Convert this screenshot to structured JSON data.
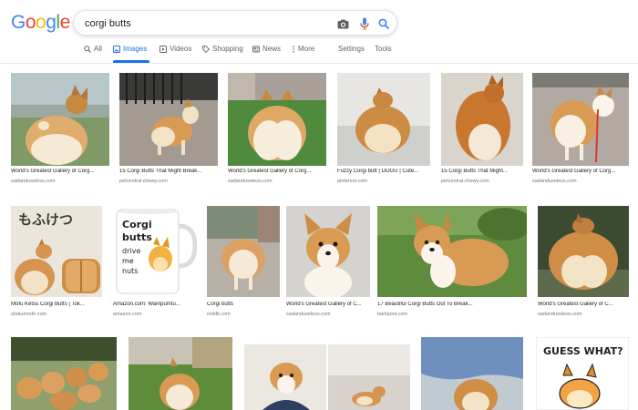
{
  "logo": {
    "letters": [
      "G",
      "o",
      "o",
      "g",
      "l",
      "e"
    ],
    "colors": [
      "#4285f4",
      "#ea4335",
      "#fbbc05",
      "#4285f4",
      "#34a853",
      "#ea4335"
    ]
  },
  "search": {
    "query": "corgi butts"
  },
  "colors": {
    "accent": "#1a73e8",
    "tab_text": "#5f6368",
    "source_text": "#70757a"
  },
  "tabs": [
    {
      "label": "All",
      "icon": "search-icon"
    },
    {
      "label": "Images",
      "icon": "image-icon",
      "active": true
    },
    {
      "label": "Videos",
      "icon": "video-icon"
    },
    {
      "label": "Shopping",
      "icon": "tag-icon"
    },
    {
      "label": "News",
      "icon": "news-icon"
    },
    {
      "label": "More",
      "icon": "more-icon"
    },
    {
      "label": "Settings"
    },
    {
      "label": "Tools"
    }
  ],
  "results": {
    "row1": [
      {
        "caption": "World's Greatest Gallery of Corg...",
        "source": "sadanduseless.com"
      },
      {
        "caption": "15 Corgi Butts That Might Break...",
        "source": "petcentral.chewy.com"
      },
      {
        "caption": "World's Greatest Gallery of Corg...",
        "source": "sadanduseless.com"
      },
      {
        "caption": "Fuzzy Corgi butt | DOGU | Cute...",
        "source": "pinterest.com"
      },
      {
        "caption": "15 Corgi Butts That Might...",
        "source": "petcentral.chewy.com"
      },
      {
        "caption": "World's Greatest Gallery of Corg...",
        "source": "sadanduseless.com"
      }
    ],
    "row2": [
      {
        "caption": "Mofu Ketsu Corgi Butts | Tok...",
        "source": "otakumode.com",
        "image_text": "もふけつ"
      },
      {
        "caption": "Amazon.com: Wampumtu...",
        "source": "amazon.com",
        "image_text": [
          "Corgi",
          "butts",
          "drive",
          "me",
          "nuts"
        ]
      },
      {
        "caption": "Corgi butts",
        "source": "reddit.com"
      },
      {
        "caption": "World's Greatest Gallery of C...",
        "source": "sadanduseless.com"
      },
      {
        "caption": "17 Beautiful Corgi Butts Out To Break...",
        "source": "barkpost.com"
      },
      {
        "caption": "World's Greatest Gallery of C...",
        "source": "sadanduseless.com"
      }
    ],
    "row3": [
      {
        "name": "corgi-group"
      },
      {
        "name": "corgi-grass"
      },
      {
        "name": "corgi-peek"
      },
      {
        "name": "corgi-floor"
      },
      {
        "name": "corgi-blanket"
      },
      {
        "name": "guess-what",
        "image_text": "GUESS WHAT?"
      }
    ]
  }
}
